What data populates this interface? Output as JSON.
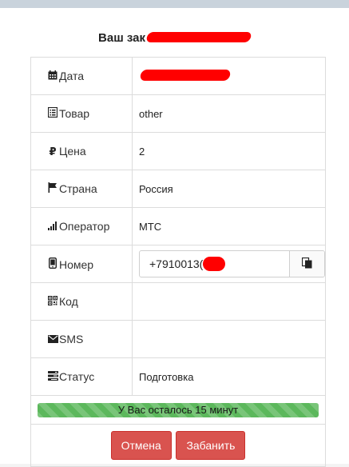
{
  "header": {
    "title_visible": "Ваш зак"
  },
  "rows": {
    "date": {
      "label": "Дата",
      "icon": "calendar-icon"
    },
    "product": {
      "label": "Товар",
      "icon": "list-icon",
      "value": "other"
    },
    "price": {
      "label": "Цена",
      "icon": "ruble-icon",
      "value": "2"
    },
    "country": {
      "label": "Страна",
      "icon": "flag-icon",
      "value": "Россия"
    },
    "operator": {
      "label": "Оператор",
      "icon": "signal-icon",
      "value": "МТС"
    },
    "number": {
      "label": "Номер",
      "icon": "phone-icon",
      "value": "+7910013("
    },
    "code": {
      "label": "Код",
      "icon": "qrcode-icon",
      "value": ""
    },
    "sms": {
      "label": "SMS",
      "icon": "envelope-icon",
      "value": ""
    },
    "status": {
      "label": "Статус",
      "icon": "tasks-icon",
      "value": "Подготовка"
    }
  },
  "progress": {
    "text": "У Вас осталось 15 минут",
    "fraction": 1.0,
    "color": "#5cb85c"
  },
  "actions": {
    "cancel": "Отмена",
    "ban": "Забанить",
    "button_color": "#d9534f"
  }
}
